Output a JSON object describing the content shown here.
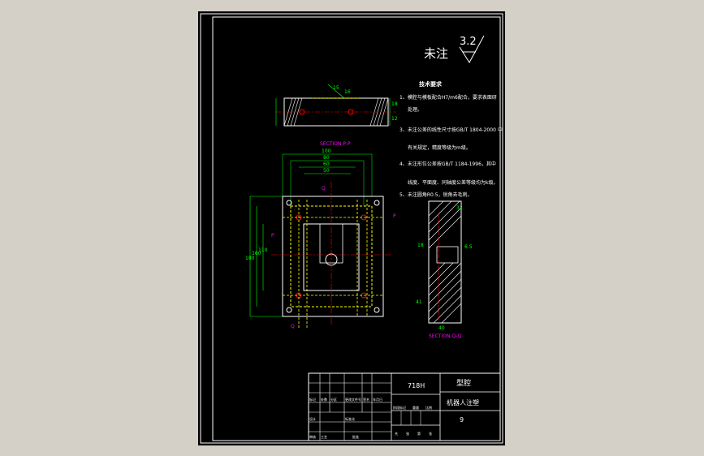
{
  "window": {
    "background": "#d4d0c8"
  },
  "colors": {
    "sheet": "#000000",
    "border": "#ffffff",
    "outline": "#ffffff",
    "dimension": "#00ff00",
    "hidden": "#ffff00",
    "center": "#ff0000",
    "section_label": "#ff00ff",
    "hatch": "#ffffff"
  },
  "roughness": {
    "prefix": "未注",
    "value": "3.2"
  },
  "technical_requirements": {
    "heading": "技术要求",
    "lines": [
      "1、模腔与模板配合H7/m6配合，要求表面研",
      "处理。",
      "3、未注公差的线性尺寸按GB/T 1804-2000 中",
      "有关规定，精度等级为m级。",
      "4、未注形位公差按GB/T 1184-1996，其中",
      "线度、平面度、同轴度公差等级均为k级。",
      "5、未注圆角R0.5，锐角去毛刺。"
    ]
  },
  "views": {
    "top_view": {
      "dims": [
        "15",
        "16",
        "18",
        "12"
      ]
    },
    "plan_view": {
      "section_title": "SECTION P-P",
      "section_marks": [
        "P",
        "P",
        "Q",
        "Q"
      ],
      "horiz_dims": [
        "100",
        "80",
        "60",
        "50"
      ],
      "vert_dims": [
        "180",
        "160",
        "110"
      ]
    },
    "side_view": {
      "section_title": "SECTION Q-Q",
      "dims": [
        "32",
        "18",
        "6.5",
        "41",
        "40"
      ]
    }
  },
  "title_block": {
    "material": "718H",
    "part_name": "型腔",
    "company": "机器人注塑",
    "sheet_no": "9",
    "labels": [
      "标记",
      "处数",
      "分区",
      "更改文件号",
      "签名",
      "年月日"
    ],
    "labels2": [
      "设计",
      "标准化",
      "阶段标记",
      "重量",
      "比例"
    ],
    "labels3": [
      "审核",
      "工艺",
      "批准",
      "共",
      "张",
      "第",
      "张"
    ]
  }
}
